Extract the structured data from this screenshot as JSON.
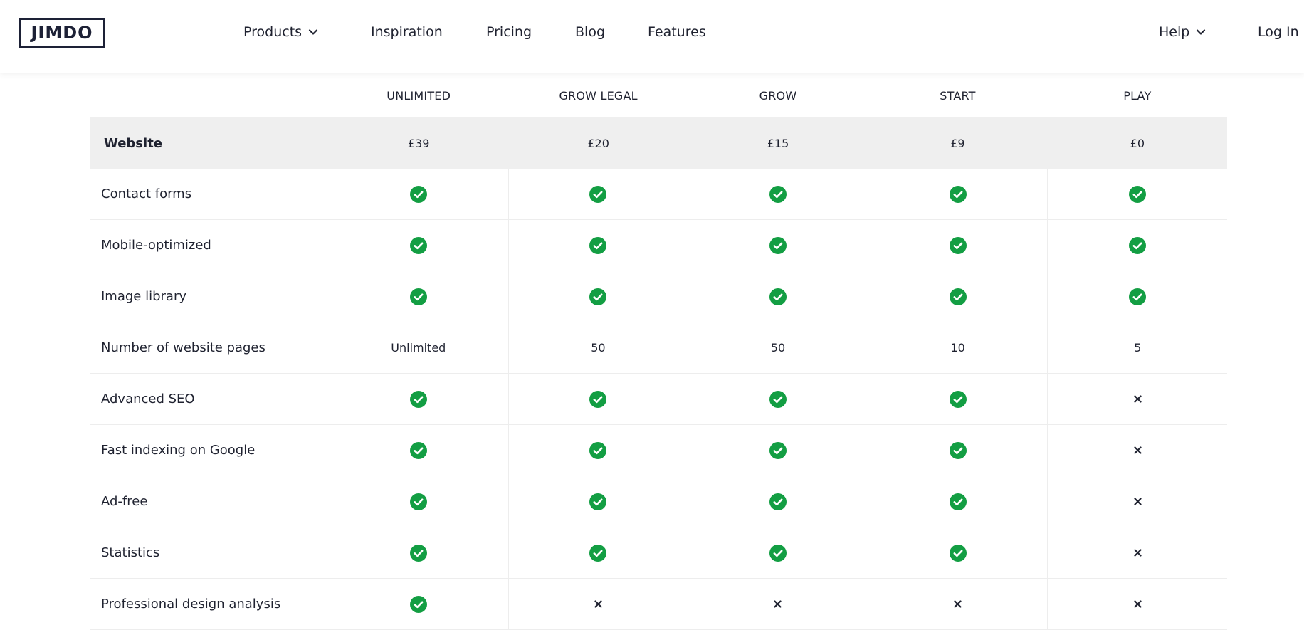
{
  "header": {
    "logo": "JIMDO",
    "nav": [
      {
        "label": "Products",
        "dropdown": true
      },
      {
        "label": "Inspiration"
      },
      {
        "label": "Pricing"
      },
      {
        "label": "Blog"
      },
      {
        "label": "Features"
      }
    ],
    "help": "Help",
    "login": "Log In"
  },
  "plans": [
    "UNLIMITED",
    "GROW LEGAL",
    "GROW",
    "START",
    "PLAY"
  ],
  "section": {
    "label": "Website",
    "prices": [
      "£39",
      "£20",
      "£15",
      "£9",
      "£0"
    ]
  },
  "features": [
    {
      "label": "Contact forms",
      "values": [
        "check",
        "check",
        "check",
        "check",
        "check"
      ]
    },
    {
      "label": "Mobile-optimized",
      "values": [
        "check",
        "check",
        "check",
        "check",
        "check"
      ]
    },
    {
      "label": "Image library",
      "values": [
        "check",
        "check",
        "check",
        "check",
        "check"
      ]
    },
    {
      "label": "Number of website pages",
      "values": [
        "Unlimited",
        "50",
        "50",
        "10",
        "5"
      ]
    },
    {
      "label": "Advanced SEO",
      "values": [
        "check",
        "check",
        "check",
        "check",
        "x"
      ]
    },
    {
      "label": "Fast indexing on Google",
      "values": [
        "check",
        "check",
        "check",
        "check",
        "x"
      ]
    },
    {
      "label": "Ad-free",
      "values": [
        "check",
        "check",
        "check",
        "check",
        "x"
      ]
    },
    {
      "label": "Statistics",
      "values": [
        "check",
        "check",
        "check",
        "check",
        "x"
      ]
    },
    {
      "label": "Professional design analysis",
      "values": [
        "check",
        "x",
        "x",
        "x",
        "x"
      ]
    }
  ],
  "colors": {
    "check": "#139e43",
    "brand": "#1d2136",
    "section_bg": "#efefef"
  }
}
